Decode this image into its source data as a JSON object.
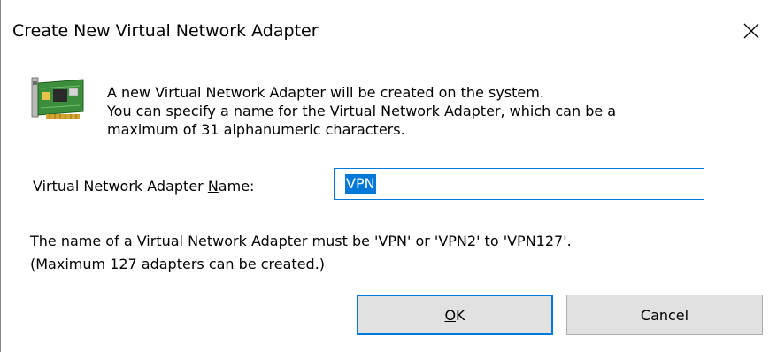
{
  "window": {
    "title": "Create New Virtual Network Adapter",
    "close_icon": "close-icon"
  },
  "intro": {
    "icon": "network-adapter-card-icon",
    "lines": [
      "A new Virtual Network Adapter will be created on the system.",
      "You can specify a name for the Virtual Network Adapter, which can be a",
      "maximum of 31 alphanumeric characters."
    ]
  },
  "name_field": {
    "label_before": "Virtual Network Adapter ",
    "label_mnemonic": "N",
    "label_after": "ame:",
    "value": "VPN"
  },
  "rules": {
    "lines": [
      "The name of a Virtual Network Adapter must be 'VPN' or 'VPN2' to 'VPN127'.",
      "(Maximum 127 adapters can be created.)"
    ]
  },
  "buttons": {
    "ok_mnemonic": "O",
    "ok_rest": "K",
    "cancel_label": "Cancel"
  },
  "colors": {
    "accent": "#0078d7",
    "button_face": "#e1e1e1",
    "button_border": "#adadad"
  }
}
